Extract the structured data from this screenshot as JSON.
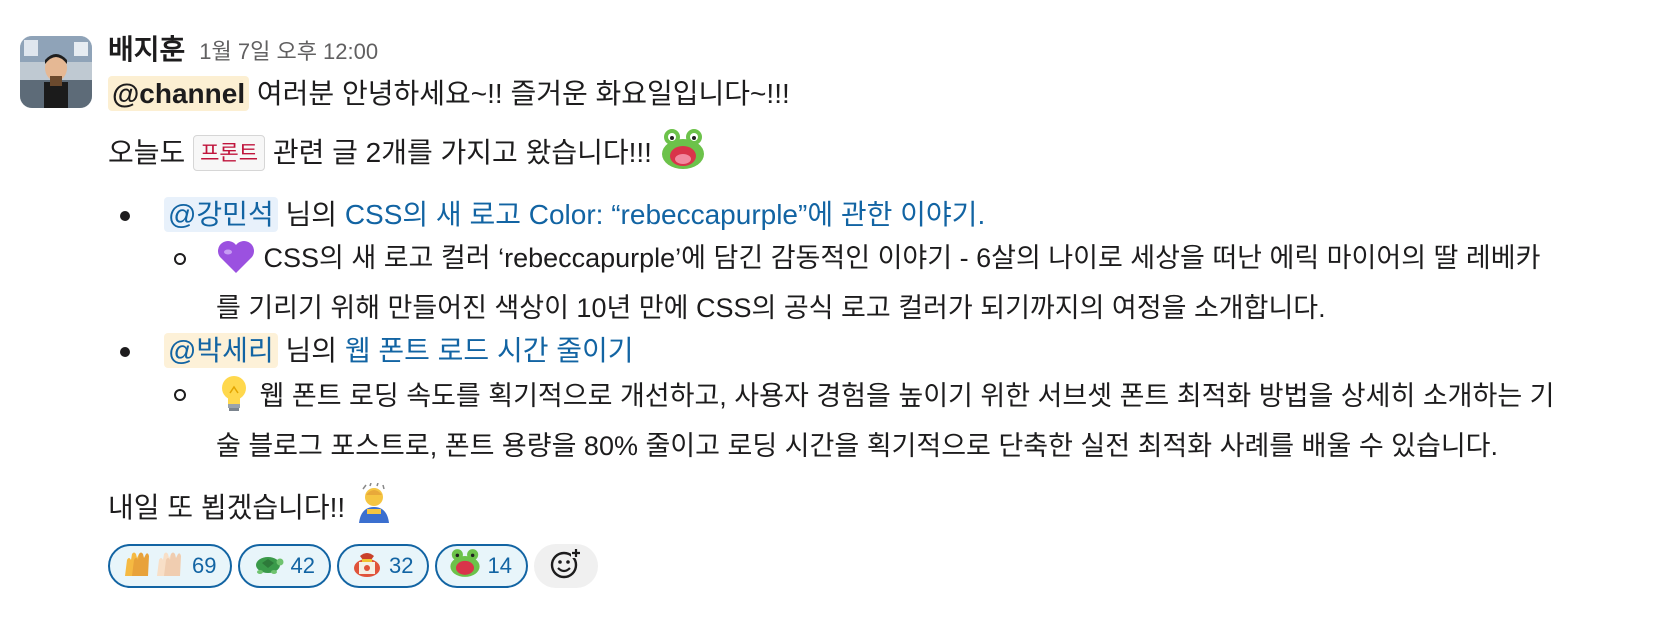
{
  "message": {
    "sender": "배지훈",
    "timestamp": "1월 7일 오후 12:00",
    "line1": {
      "mention": "@channel",
      "text": "여러분 안녕하세요~!!  즐거운 화요일입니다~!!!"
    },
    "line2": {
      "before": "오늘도",
      "tag": "프론트",
      "after": "관련 글 2개를 가지고 왔습니다!!!",
      "emoji": "frog-emoji"
    },
    "items": [
      {
        "mention": "@강민석",
        "suffix": "님의",
        "link": "CSS의 새 로고 Color: “rebeccapurple”에 관한 이야기.",
        "emoji": "purple-heart-emoji",
        "description": "CSS의 새 로고 컬러 ‘rebeccapurple’에 담긴 감동적인 이야기 - 6살의 나이로 세상을 떠난 에릭 마이어의 딸 레베카를 기리기 위해 만들어진 색상이 10년 만에 CSS의 공식 로고 컬러가 되기까지의 여정을 소개합니다."
      },
      {
        "mention": "@박세리",
        "suffix": "님의",
        "link": "웹 폰트 로드 시간 줄이기",
        "emoji": "light-bulb-emoji",
        "description": "웹 폰트 로딩 속도를 획기적으로 개선하고, 사용자 경험을 높이기 위한 서브셋 폰트 최적화 방법을 상세히 소개하는 기술 블로그 포스트로, 폰트 용량을 80% 줄이고 로딩 시간을 획기적으로 단축한 실전 최적화 사례를 배울 수 있습니다."
      }
    ],
    "closing": {
      "text": "내일 또 뵙겠습니다!!",
      "emoji": "bowing-person-emoji"
    }
  },
  "reactions": [
    {
      "emoji": "raised-hands-emoji",
      "count": "69"
    },
    {
      "emoji": "turtle-emoji",
      "count": "42"
    },
    {
      "emoji": "lucky-pouch-emoji",
      "count": "32"
    },
    {
      "emoji": "frog-emoji",
      "count": "14"
    }
  ],
  "colors": {
    "link": "#1264a3",
    "tag_text": "#c0143c",
    "channel_highlight": "#fcefd2",
    "reaction_bg": "#e8f5fa"
  }
}
